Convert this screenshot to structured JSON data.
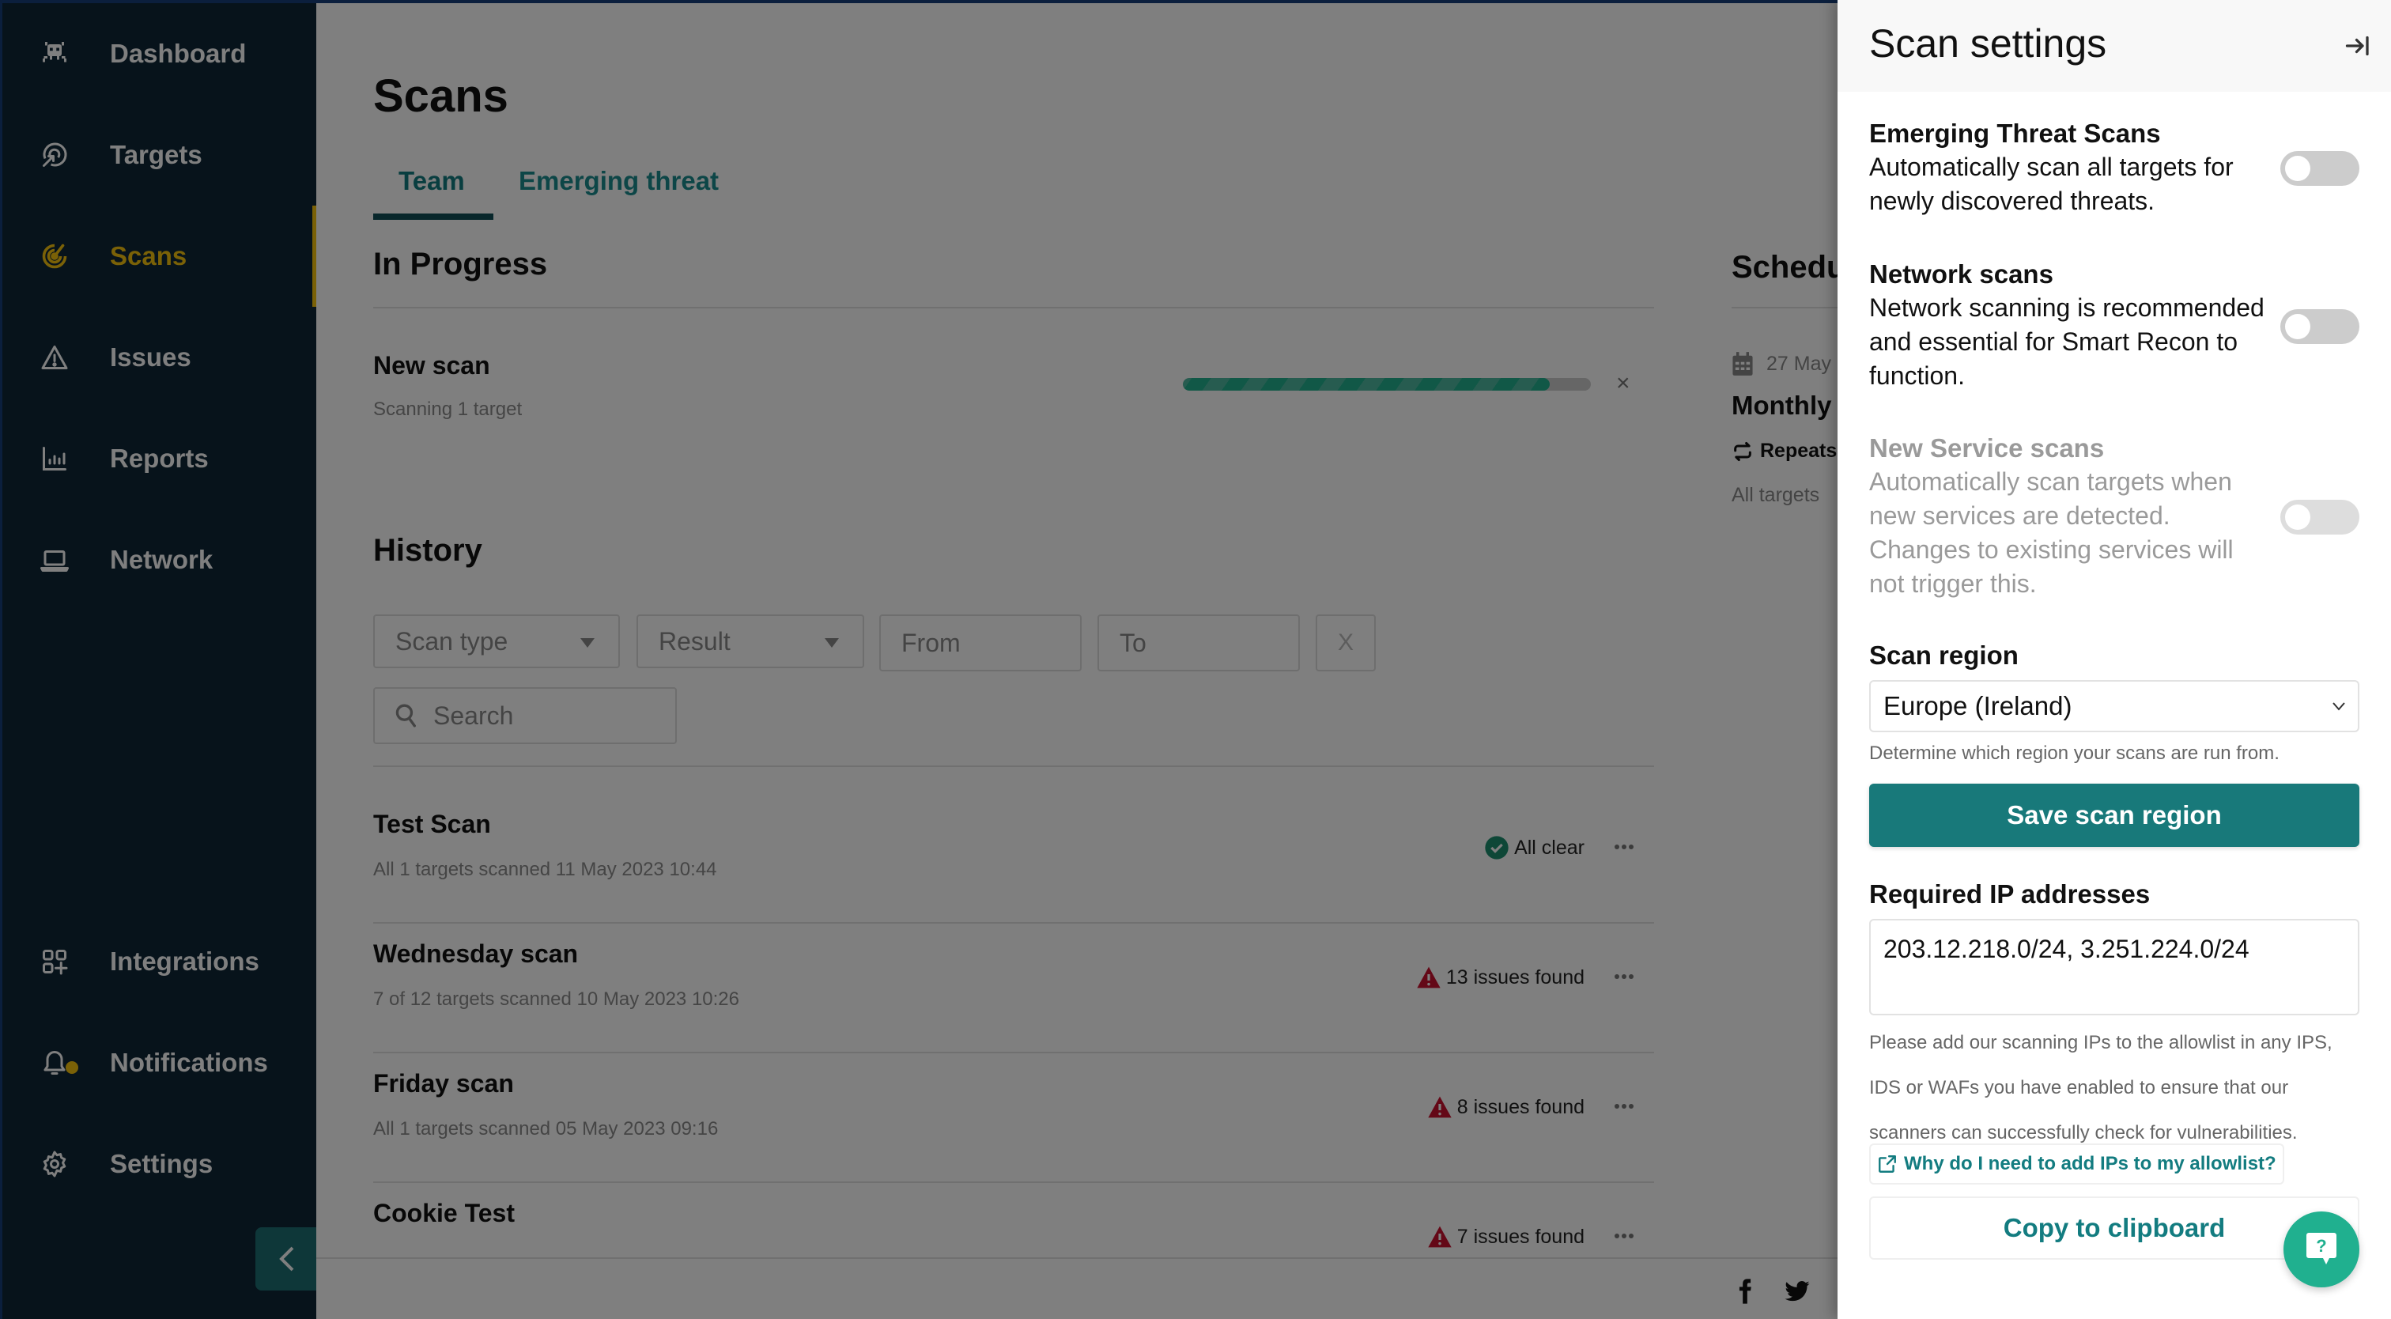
{
  "sidebar": {
    "items": [
      {
        "label": "Dashboard",
        "icon": "space-invader-icon"
      },
      {
        "label": "Targets",
        "icon": "target-arrow-icon"
      },
      {
        "label": "Scans",
        "icon": "radar-icon",
        "active": true
      },
      {
        "label": "Issues",
        "icon": "warning-triangle-icon"
      },
      {
        "label": "Reports",
        "icon": "bar-chart-icon"
      },
      {
        "label": "Network",
        "icon": "laptop-icon"
      },
      {
        "label": "Integrations",
        "icon": "grid-plus-icon"
      },
      {
        "label": "Notifications",
        "icon": "bell-icon",
        "badge": true
      },
      {
        "label": "Settings",
        "icon": "gear-icon"
      }
    ],
    "collapse_icon": "chevron-left-icon"
  },
  "page": {
    "title": "Scans",
    "tabs": [
      {
        "label": "Team",
        "active": true
      },
      {
        "label": "Emerging threat",
        "active": false
      }
    ],
    "in_progress": {
      "title": "In Progress",
      "scan": {
        "name": "New scan",
        "subtitle": "Scanning 1 target",
        "progress_percent": 90,
        "cancel": "×"
      }
    },
    "history": {
      "title": "History",
      "filters": {
        "scan_type": "Scan type",
        "result": "Result",
        "from_placeholder": "From",
        "to_placeholder": "To",
        "clear": "X",
        "search_placeholder": "Search"
      },
      "rows": [
        {
          "name": "Test Scan",
          "subtitle": "All 1 targets scanned 11 May 2023 10:44",
          "status": "All clear",
          "status_type": "clear"
        },
        {
          "name": "Wednesday scan",
          "subtitle": "7 of 12 targets scanned 10 May 2023 10:26",
          "status": "13 issues found",
          "status_type": "issues"
        },
        {
          "name": "Friday scan",
          "subtitle": "All 1 targets scanned 05 May 2023 09:16",
          "status": "8 issues found",
          "status_type": "issues"
        },
        {
          "name": "Cookie Test",
          "subtitle": "",
          "status": "7 issues found",
          "status_type": "issues"
        }
      ]
    },
    "scheduled": {
      "title": "Schedu",
      "date": "27 May",
      "name": "Monthly",
      "repeat": "Repeats",
      "targets": "All targets"
    },
    "footer": {
      "social": [
        "facebook-icon",
        "twitter-icon"
      ]
    }
  },
  "panel": {
    "title": "Scan settings",
    "close_icon": "collapse-right-icon",
    "settings": [
      {
        "title": "Emerging Threat Scans",
        "description": "Automatically scan all targets for newly discovered threats.",
        "enabled": false,
        "disabled": false
      },
      {
        "title": "Network scans",
        "description": "Network scanning is recommended and essential for Smart Recon to function.",
        "enabled": false,
        "disabled": false
      },
      {
        "title": "New Service scans",
        "description": "Automatically scan targets when new services are detected. Changes to existing services will not trigger this.",
        "enabled": false,
        "disabled": true
      }
    ],
    "region": {
      "label": "Scan region",
      "selected": "Europe (Ireland)",
      "help": "Determine which region your scans are run from.",
      "save_label": "Save scan region"
    },
    "ips": {
      "label": "Required IP addresses",
      "value": "203.12.218.0/24, 3.251.224.0/24",
      "help": "Please add our scanning IPs to the allowlist in any IPS, IDS or WAFs you have enabled to ensure that our scanners can successfully check for vulnerabilities.",
      "link": "Why do I need to add IPs to my allowlist?",
      "copy_label": "Copy to clipboard"
    },
    "help_button": "?"
  },
  "colors": {
    "accent_teal": "#18797a",
    "active_nav": "#f5c20f",
    "issue_red": "#c8102e",
    "clear_green": "#1d8f6f"
  }
}
